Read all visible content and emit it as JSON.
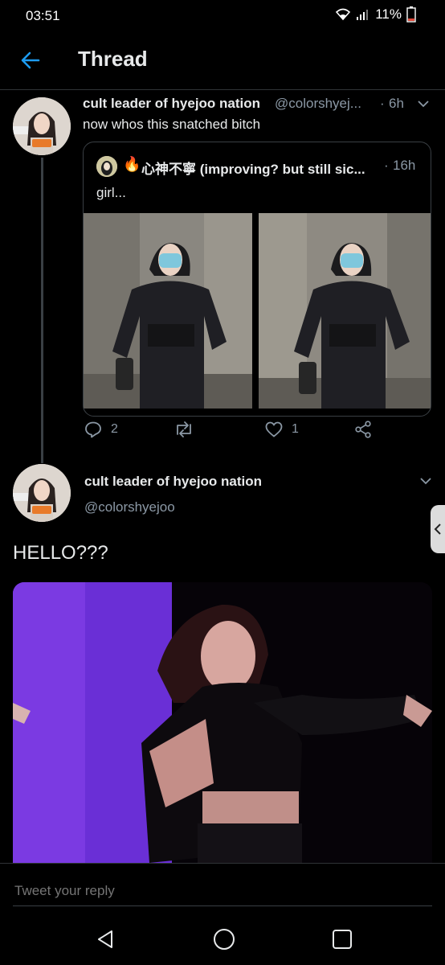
{
  "status_bar": {
    "time": "03:51",
    "battery": "11%"
  },
  "header": {
    "title": "Thread"
  },
  "tweet1": {
    "name": "cult leader of hyejoo nation",
    "handle": "@colorshyej...",
    "separator": "·",
    "time": "6h",
    "text": "now whos this snatched bitch",
    "quote": {
      "emoji": "🔥",
      "name": "心神不寧 (improving? but still sic...",
      "separator": "·",
      "time": "16h",
      "text": "girl..."
    },
    "actions": {
      "replies": "2",
      "retweets": "",
      "likes": "1"
    }
  },
  "tweet2": {
    "name": "cult leader of hyejoo nation",
    "handle": "@colorshyejoo",
    "text": "HELLO???"
  },
  "reply": {
    "placeholder": "Tweet your reply"
  },
  "colors": {
    "accent": "#1d9bf0",
    "background": "#000000",
    "muted": "#8b98a5"
  },
  "icons": [
    "back-arrow-icon",
    "chevron-down-icon",
    "reply-icon",
    "retweet-icon",
    "like-icon",
    "share-icon",
    "back-nav-icon",
    "home-nav-icon",
    "recents-nav-icon"
  ]
}
